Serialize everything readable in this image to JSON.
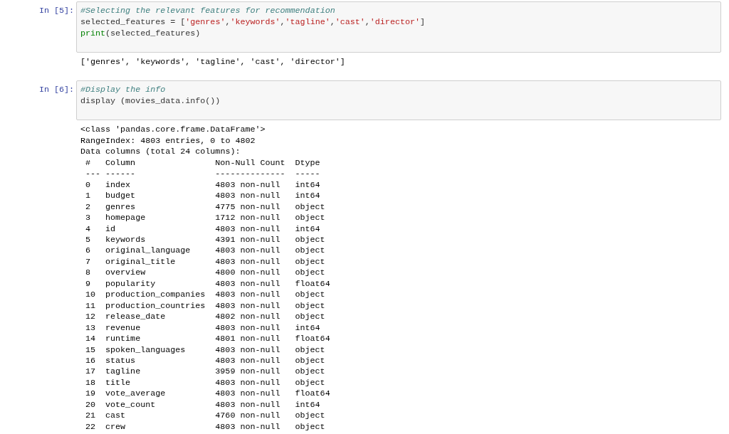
{
  "cells": [
    {
      "prompt": "In [5]:",
      "code": [
        [
          {
            "kind": "comment",
            "text": "#Selecting the relevant features for recommendation"
          }
        ],
        [
          {
            "kind": "name",
            "text": "selected_features = ["
          },
          {
            "kind": "string",
            "text": "'genres'"
          },
          {
            "kind": "name",
            "text": ","
          },
          {
            "kind": "string",
            "text": "'keywords'"
          },
          {
            "kind": "name",
            "text": ","
          },
          {
            "kind": "string",
            "text": "'tagline'"
          },
          {
            "kind": "name",
            "text": ","
          },
          {
            "kind": "string",
            "text": "'cast'"
          },
          {
            "kind": "name",
            "text": ","
          },
          {
            "kind": "string",
            "text": "'director'"
          },
          {
            "kind": "name",
            "text": "]"
          }
        ],
        [
          {
            "kind": "builtin",
            "text": "print"
          },
          {
            "kind": "name",
            "text": "(selected_features)"
          }
        ]
      ],
      "output": {
        "lines": [
          "['genres', 'keywords', 'tagline', 'cast', 'director']"
        ]
      }
    },
    {
      "prompt": "In [6]:",
      "code": [
        [
          {
            "kind": "comment",
            "text": "#Display the info"
          }
        ],
        [
          {
            "kind": "name",
            "text": "display (movies_data.info())"
          }
        ]
      ],
      "output": {
        "lines": [
          "<class 'pandas.core.frame.DataFrame'>",
          "RangeIndex: 4803 entries, 0 to 4802",
          "Data columns (total 24 columns):"
        ],
        "table": {
          "columns": [
            "#",
            "Column",
            "Non-Null Count",
            "Dtype"
          ],
          "rows": [
            [
              "---",
              "------",
              "--------------",
              "-----"
            ],
            [
              "0",
              "index",
              "4803 non-null",
              "int64"
            ],
            [
              "1",
              "budget",
              "4803 non-null",
              "int64"
            ],
            [
              "2",
              "genres",
              "4775 non-null",
              "object"
            ],
            [
              "3",
              "homepage",
              "1712 non-null",
              "object"
            ],
            [
              "4",
              "id",
              "4803 non-null",
              "int64"
            ],
            [
              "5",
              "keywords",
              "4391 non-null",
              "object"
            ],
            [
              "6",
              "original_language",
              "4803 non-null",
              "object"
            ],
            [
              "7",
              "original_title",
              "4803 non-null",
              "object"
            ],
            [
              "8",
              "overview",
              "4800 non-null",
              "object"
            ],
            [
              "9",
              "popularity",
              "4803 non-null",
              "float64"
            ],
            [
              "10",
              "production_companies",
              "4803 non-null",
              "object"
            ],
            [
              "11",
              "production_countries",
              "4803 non-null",
              "object"
            ],
            [
              "12",
              "release_date",
              "4802 non-null",
              "object"
            ],
            [
              "13",
              "revenue",
              "4803 non-null",
              "int64"
            ],
            [
              "14",
              "runtime",
              "4801 non-null",
              "float64"
            ],
            [
              "15",
              "spoken_languages",
              "4803 non-null",
              "object"
            ],
            [
              "16",
              "status",
              "4803 non-null",
              "object"
            ],
            [
              "17",
              "tagline",
              "3959 non-null",
              "object"
            ],
            [
              "18",
              "title",
              "4803 non-null",
              "object"
            ],
            [
              "19",
              "vote_average",
              "4803 non-null",
              "float64"
            ],
            [
              "20",
              "vote_count",
              "4803 non-null",
              "int64"
            ],
            [
              "21",
              "cast",
              "4760 non-null",
              "object"
            ],
            [
              "22",
              "crew",
              "4803 non-null",
              "object"
            ]
          ]
        }
      }
    }
  ]
}
